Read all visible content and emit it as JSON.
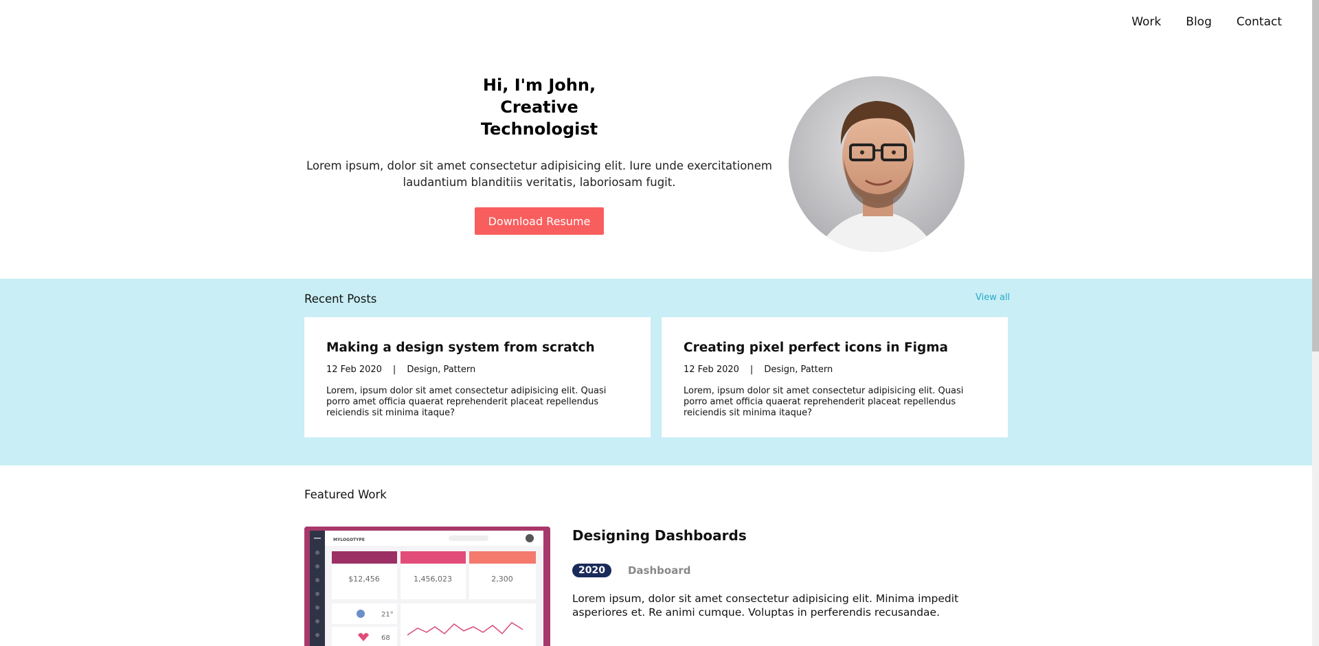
{
  "nav": {
    "work": "Work",
    "blog": "Blog",
    "contact": "Contact"
  },
  "hero": {
    "title_line1": "Hi, I'm John,",
    "title_line2": "Creative",
    "title_line3": "Technologist",
    "description": "Lorem ipsum, dolor sit amet consectetur adipisicing elit. Iure unde exercitationem laudantium blanditiis veritatis, laboriosam fugit.",
    "button": "Download Resume"
  },
  "recent": {
    "heading": "Recent Posts",
    "view_all": "View all",
    "posts": [
      {
        "title": "Making a design system from scratch",
        "date": "12 Feb 2020",
        "separator": "|",
        "tags": "Design, Pattern",
        "excerpt": "Lorem, ipsum dolor sit amet consectetur adipisicing elit. Quasi porro amet officia quaerat reprehenderit placeat repellendus reiciendis sit minima itaque?"
      },
      {
        "title": "Creating pixel perfect icons in Figma",
        "date": "12 Feb 2020",
        "separator": "|",
        "tags": "Design, Pattern",
        "excerpt": "Lorem, ipsum dolor sit amet consectetur adipisicing elit. Quasi porro amet officia quaerat reprehenderit placeat repellendus reiciendis sit minima itaque?"
      }
    ]
  },
  "featured": {
    "heading": "Featured Work",
    "work": {
      "title": "Designing Dashboards",
      "year": "2020",
      "tag": "Dashboard",
      "description": "Lorem ipsum, dolor sit amet consectetur adipisicing elit. Minima impedit asperiores et. Re animi cumque. Voluptas in perferendis recusandae."
    },
    "thumbnail": {
      "logo": "MYLOGOTYPE",
      "stat1": "$12,456",
      "stat2": "1,456,023",
      "stat3": "2,300",
      "weather": "21°",
      "health": "68"
    }
  },
  "colors": {
    "accent": "#f95e5e",
    "recent_bg": "#c9eef5",
    "link": "#26a9c9",
    "badge": "#1a2a5a"
  }
}
